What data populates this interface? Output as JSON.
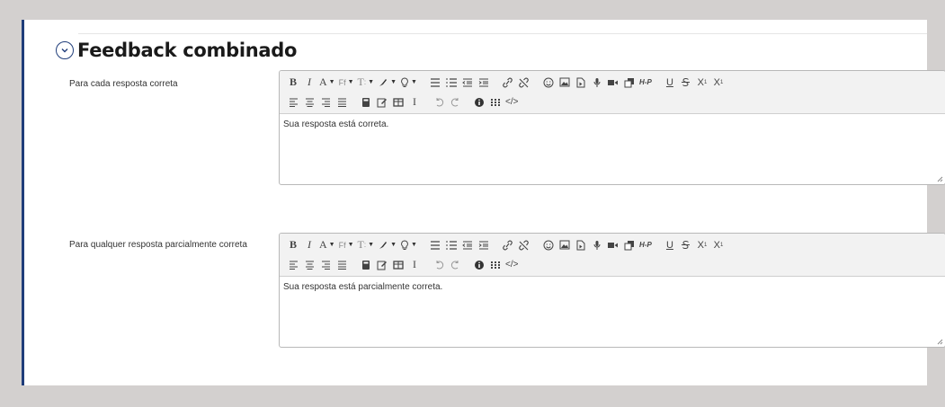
{
  "section": {
    "title": "Feedback combinado",
    "toggle_icon": "chevron-down-icon"
  },
  "fields": [
    {
      "label": "Para cada resposta correta",
      "content": "Sua resposta está correta."
    },
    {
      "label": "Para qualquer resposta parcialmente correta",
      "content": "Sua resposta está parcialmente correta."
    }
  ],
  "toolbar_text": {
    "bold": "B",
    "italic": "I",
    "font_color": "A",
    "font_family": "Ff",
    "font_size": "T",
    "underline": "U",
    "subscript": "X",
    "subscript_sub": "1",
    "superscript": "X",
    "superscript_sup": "1",
    "cursor": "I",
    "h5p": "H-P",
    "source": "</>"
  },
  "colors": {
    "accent": "#1f3d7a",
    "page_bg": "#d3d0cf",
    "toolbar_bg": "#f2f2f2"
  }
}
